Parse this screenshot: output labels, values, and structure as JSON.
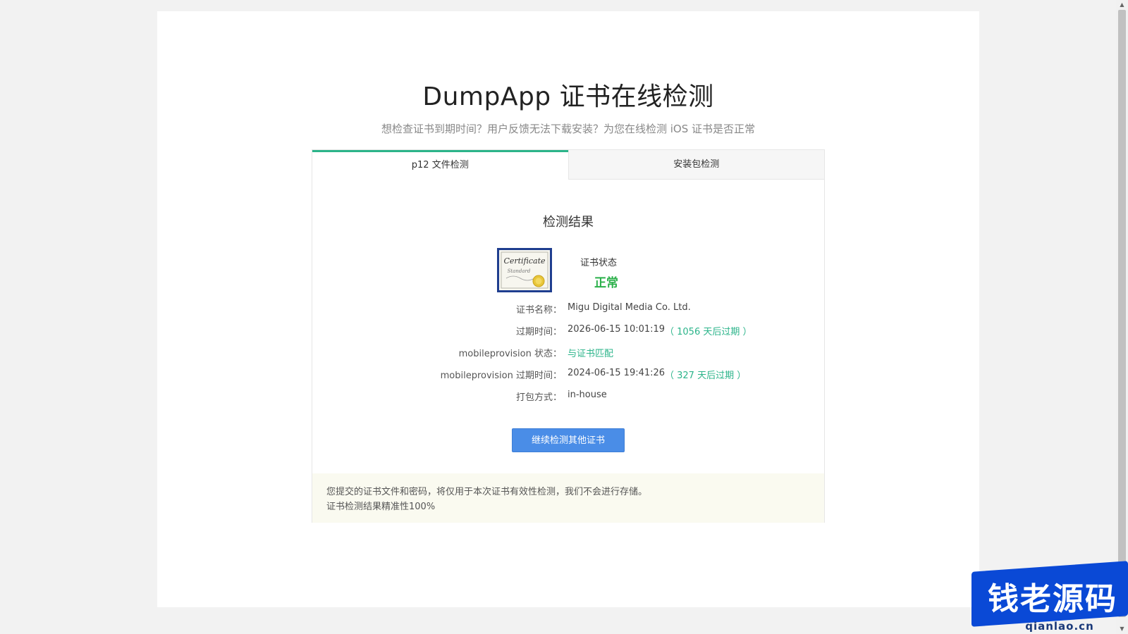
{
  "header": {
    "title": "DumpApp 证书在线检测",
    "subtitle": "想检查证书到期时间？用户反馈无法下载安装？为您在线检测 iOS 证书是否正常"
  },
  "tabs": [
    {
      "label": "p12 文件检测",
      "active": true
    },
    {
      "label": "安装包检测",
      "active": false
    }
  ],
  "result": {
    "title": "检测结果",
    "status_label": "证书状态",
    "status_value": "正常",
    "rows": [
      {
        "label": "证书名称：",
        "value": "Migu Digital Media Co. Ltd.",
        "note": ""
      },
      {
        "label": "过期时间：",
        "value": "2026-06-15 10:01:19",
        "note": "（ 1056 天后过期 ）"
      },
      {
        "label": "mobileprovision 状态：",
        "value": "与证书匹配",
        "note": ""
      },
      {
        "label": "mobileprovision 过期时间：",
        "value": "2024-06-15 19:41:26",
        "note": "（ 327 天后过期 ）"
      },
      {
        "label": "打包方式：",
        "value": "in-house",
        "note": ""
      }
    ],
    "button_label": "继续检测其他证书"
  },
  "notice": {
    "line1": "您提交的证书文件和密码，将仅用于本次证书有效性检测，我们不会进行存储。",
    "line2": "证书检测结果精准性100%"
  },
  "watermark": {
    "text": "钱老源码",
    "sub": "qianlao.cn"
  },
  "colors": {
    "accent_green": "#2bb48a",
    "status_green": "#2bb04a",
    "button_blue": "#4a8de7",
    "notice_bg": "#fafaf0"
  }
}
